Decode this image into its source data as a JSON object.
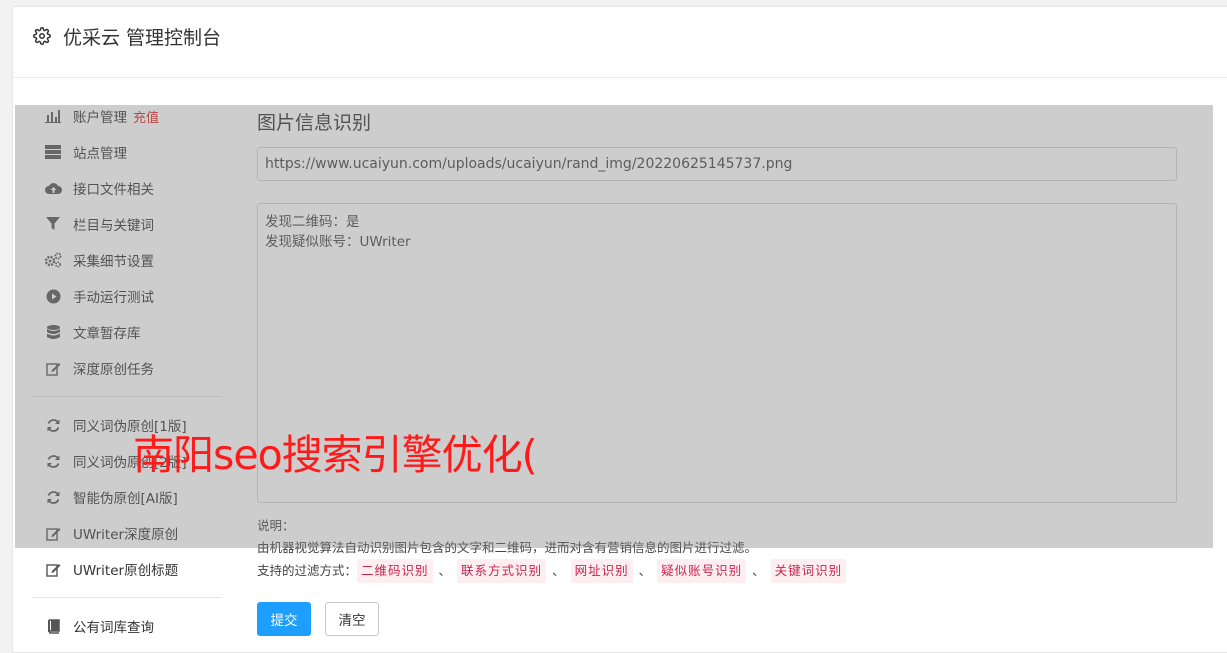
{
  "header": {
    "title": "优采云 管理控制台",
    "icon": "gear-icon"
  },
  "sidebar": {
    "items": [
      {
        "label": "账户管理",
        "badge": "充值",
        "icon": "bar-chart-icon"
      },
      {
        "label": "站点管理",
        "icon": "server-icon"
      },
      {
        "label": "接口文件相关",
        "icon": "cloud-upload-icon"
      },
      {
        "label": "栏目与关键词",
        "icon": "filter-icon"
      },
      {
        "label": "采集细节设置",
        "icon": "cogs-icon"
      },
      {
        "label": "手动运行测试",
        "icon": "play-circle-icon"
      },
      {
        "label": "文章暂存库",
        "icon": "database-icon"
      },
      {
        "label": "深度原创任务",
        "icon": "edit-icon"
      },
      {
        "label": "同义词伪原创[1版]",
        "icon": "refresh-icon"
      },
      {
        "label": "同义词伪原创[2版]",
        "icon": "refresh-icon"
      },
      {
        "label": "智能伪原创[AI版]",
        "icon": "refresh-icon"
      },
      {
        "label": "UWriter深度原创",
        "icon": "edit-icon"
      },
      {
        "label": "UWriter原创标题",
        "icon": "edit-icon"
      },
      {
        "label": "公有词库查询",
        "icon": "book-icon"
      }
    ]
  },
  "main": {
    "title": "图片信息识别",
    "url_value": "https://www.ucaiyun.com/uploads/ucaiyun/rand_img/20220625145737.png",
    "result_text": "发现二维码：是\n发现疑似账号：UWriter",
    "notes_label": "说明：",
    "notes_desc": "由机器视觉算法自动识别图片包含的文字和二维码，进而对含有营销信息的图片进行过滤。",
    "filter_label": "支持的过滤方式：",
    "filters": [
      "二维码识别",
      "联系方式识别",
      "网址识别",
      "疑似账号识别",
      "关键词识别"
    ],
    "filter_sep": "、",
    "submit_label": "提交",
    "clear_label": "清空"
  },
  "watermark": "南阳seo搜索引擎优化(",
  "colors": {
    "primary": "#1e9fff",
    "recharge": "#e02020",
    "tag_text": "#c7254e",
    "tag_bg": "#fdeef2",
    "watermark": "#ff1a1a"
  }
}
